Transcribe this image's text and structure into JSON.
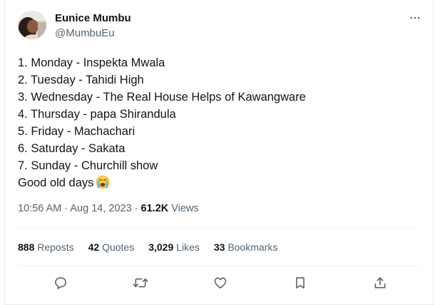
{
  "author": {
    "display_name": "Eunice Mumbu",
    "handle": "@MumbuEu",
    "avatar_icon": "profile-photo"
  },
  "more_icon": "more-horizontal-icon",
  "tweet": {
    "lines": [
      "1. Monday - Inspekta Mwala",
      "2. Tuesday - Tahidi High",
      "3. Wednesday - The Real House Helps of Kawangware",
      "4. Thursday - papa Shirandula",
      "5. Friday - Machachari",
      "6. Saturday - Sakata",
      "7. Sunday - Churchill show",
      "Good old days"
    ],
    "closing_emoji": "loudly-crying-face-emoji"
  },
  "meta": {
    "time": "10:56 AM",
    "separator": " · ",
    "date": "Aug 14, 2023",
    "views_count": "61.2K",
    "views_label": "Views"
  },
  "stats": {
    "reposts_count": "888",
    "reposts_label": "Reposts",
    "quotes_count": "42",
    "quotes_label": "Quotes",
    "likes_count": "3,029",
    "likes_label": "Likes",
    "bookmarks_count": "33",
    "bookmarks_label": "Bookmarks"
  },
  "actions": [
    "reply-icon",
    "repost-icon",
    "like-icon",
    "bookmark-icon",
    "share-icon"
  ],
  "colors": {
    "text_primary": "#0f1419",
    "text_secondary": "#536471",
    "divider": "#eff3f4",
    "icon": "#536471"
  }
}
